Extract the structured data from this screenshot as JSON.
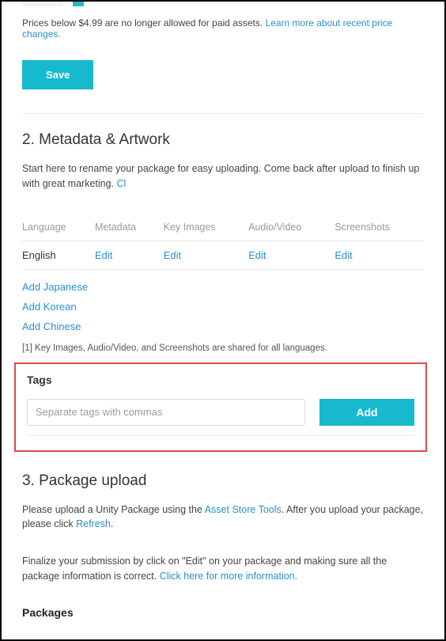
{
  "pricing": {
    "notice_text": "Prices below $4.99 are no longer allowed for paid assets. ",
    "learn_more": "Learn more about recent price changes."
  },
  "save_label": "Save",
  "section2": {
    "title": "2. Metadata & Artwork",
    "desc_prefix": "Start here to rename your package for easy uploading. Come back after upload to finish up with great marketing. ",
    "desc_link": "Cl",
    "headers": {
      "language": "Language",
      "metadata": "Metadata",
      "keyimages": "Key Images",
      "audiovideo": "Audio/Video",
      "screenshots": "Screenshots"
    },
    "row": {
      "language": "English",
      "edit": "Edit"
    },
    "add_japanese": "Add Japanese",
    "add_korean": "Add Korean",
    "add_chinese": "Add Chinese",
    "footnote": "[1] Key Images, Audio/Video, and Screenshots are shared for all languages."
  },
  "tags": {
    "title": "Tags",
    "placeholder": "Separate tags with commas",
    "add_label": "Add"
  },
  "section3": {
    "title": "3. Package upload",
    "line1_a": "Please upload a Unity Package using the ",
    "line1_link1": "Asset Store Tools",
    "line1_b": ". After you upload your package, please click ",
    "line1_link2": "Refresh",
    "line1_c": ".",
    "line2_a": "Finalize your submission by click on \"Edit\" on your package and making sure all the package information is correct. ",
    "line2_link": "Click here for more information."
  },
  "packages_title": "Packages"
}
